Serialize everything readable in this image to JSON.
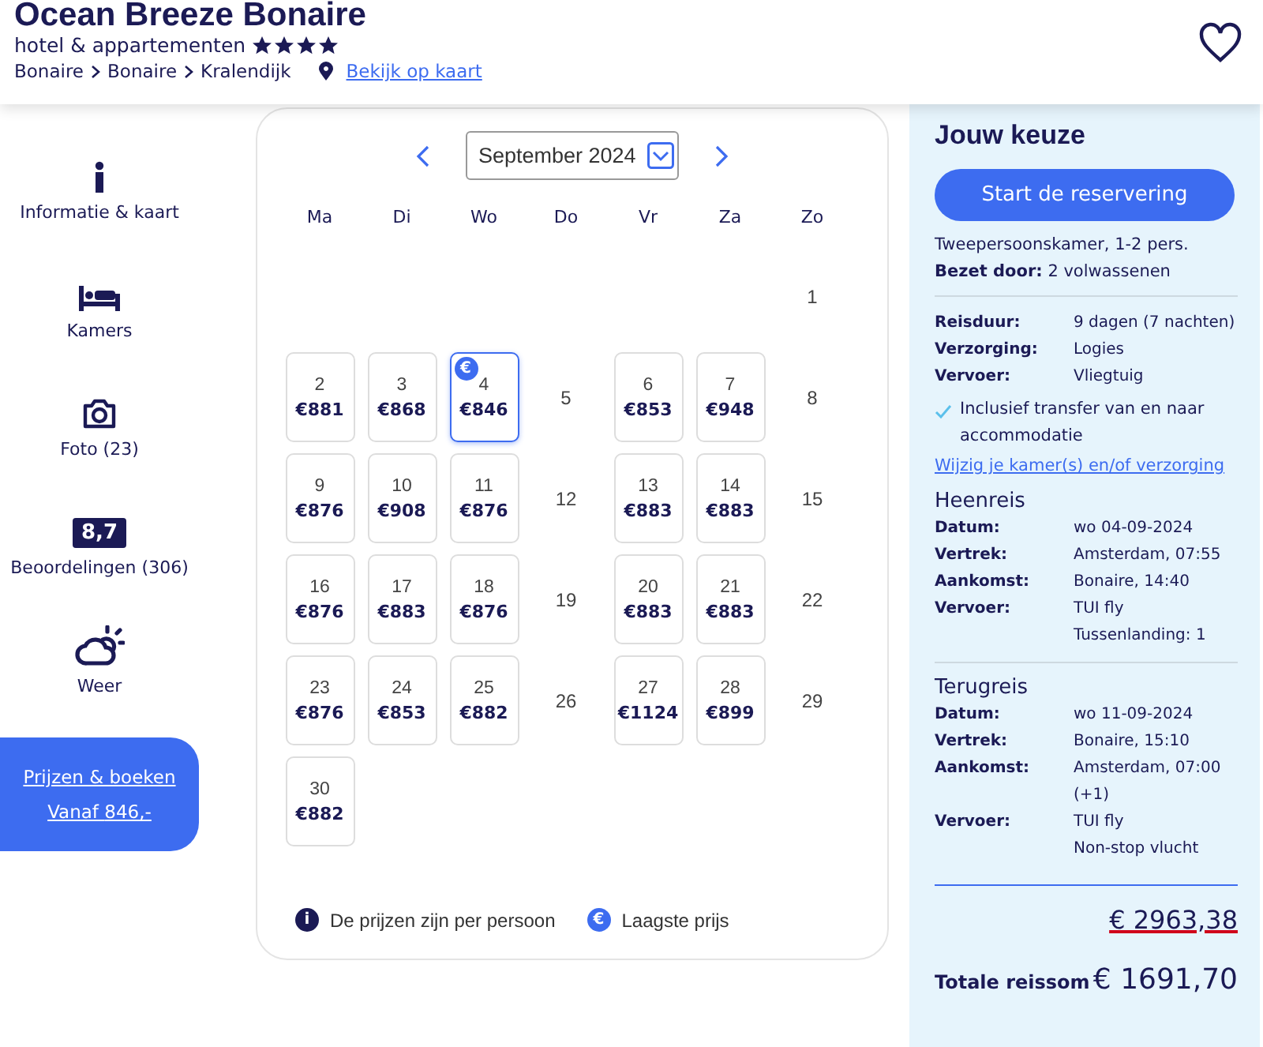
{
  "header": {
    "title": "Ocean Breeze Bonaire",
    "subtitle": "hotel & appartementen",
    "stars": 4,
    "breadcrumbs": [
      "Bonaire",
      "Bonaire",
      "Kralendijk"
    ],
    "map_link": "Bekijk op kaart"
  },
  "sidebar": {
    "items": [
      {
        "kind": "info",
        "label": "Informatie & kaart"
      },
      {
        "kind": "bed",
        "label": "Kamers"
      },
      {
        "kind": "camera",
        "label": "Foto (23)"
      },
      {
        "kind": "rating",
        "badge": "8,7",
        "label": "Beoordelingen (306)"
      },
      {
        "kind": "weather",
        "label": "Weer"
      }
    ],
    "book_button": {
      "label": "Prijzen & boeken",
      "from_label": "Vanaf",
      "price": "846,-"
    }
  },
  "calendar": {
    "month": "September 2024",
    "weekdays": [
      "Ma",
      "Di",
      "Wo",
      "Do",
      "Vr",
      "Za",
      "Zo"
    ],
    "weeks": [
      [
        {
          "kind": "blank"
        },
        {
          "kind": "blank"
        },
        {
          "kind": "blank"
        },
        {
          "kind": "blank"
        },
        {
          "kind": "blank"
        },
        {
          "kind": "blank"
        },
        {
          "kind": "plain",
          "day": "1"
        }
      ],
      [
        {
          "kind": "priced",
          "day": "2",
          "price": "€881",
          "selected": false
        },
        {
          "kind": "priced",
          "day": "3",
          "price": "€868",
          "selected": false
        },
        {
          "kind": "priced",
          "day": "4",
          "price": "€846",
          "selected": true,
          "lowest_badge": "€"
        },
        {
          "kind": "plain",
          "day": "5"
        },
        {
          "kind": "priced",
          "day": "6",
          "price": "€853",
          "selected": false
        },
        {
          "kind": "priced",
          "day": "7",
          "price": "€948",
          "selected": false
        },
        {
          "kind": "plain",
          "day": "8"
        }
      ],
      [
        {
          "kind": "priced",
          "day": "9",
          "price": "€876",
          "selected": false
        },
        {
          "kind": "priced",
          "day": "10",
          "price": "€908",
          "selected": false
        },
        {
          "kind": "priced",
          "day": "11",
          "price": "€876",
          "selected": false
        },
        {
          "kind": "plain",
          "day": "12"
        },
        {
          "kind": "priced",
          "day": "13",
          "price": "€883",
          "selected": false
        },
        {
          "kind": "priced",
          "day": "14",
          "price": "€883",
          "selected": false
        },
        {
          "kind": "plain",
          "day": "15"
        }
      ],
      [
        {
          "kind": "priced",
          "day": "16",
          "price": "€876",
          "selected": false
        },
        {
          "kind": "priced",
          "day": "17",
          "price": "€883",
          "selected": false
        },
        {
          "kind": "priced",
          "day": "18",
          "price": "€876",
          "selected": false
        },
        {
          "kind": "plain",
          "day": "19"
        },
        {
          "kind": "priced",
          "day": "20",
          "price": "€883",
          "selected": false
        },
        {
          "kind": "priced",
          "day": "21",
          "price": "€883",
          "selected": false
        },
        {
          "kind": "plain",
          "day": "22"
        }
      ],
      [
        {
          "kind": "priced",
          "day": "23",
          "price": "€876",
          "selected": false
        },
        {
          "kind": "priced",
          "day": "24",
          "price": "€853",
          "selected": false
        },
        {
          "kind": "priced",
          "day": "25",
          "price": "€882",
          "selected": false
        },
        {
          "kind": "plain",
          "day": "26"
        },
        {
          "kind": "priced",
          "day": "27",
          "price": "€1124",
          "selected": false
        },
        {
          "kind": "priced",
          "day": "28",
          "price": "€899",
          "selected": false
        },
        {
          "kind": "plain",
          "day": "29"
        }
      ],
      [
        {
          "kind": "priced",
          "day": "30",
          "price": "€882",
          "selected": false
        }
      ]
    ],
    "legend": [
      {
        "kind": "info",
        "icon": "i",
        "text": "De prijzen zijn per persoon"
      },
      {
        "kind": "lowest",
        "icon": "€",
        "text": "Laagste prijs"
      }
    ]
  },
  "summary": {
    "title": "Jouw keuze",
    "button": "Start de reservering",
    "room": "Tweepersoonskamer, 1-2 pers.",
    "occupancy": "**Bezet door:** 2 volwassenen",
    "details": [
      {
        "label": "Reisduur:",
        "lines": [
          "9 dagen (7 nachten)"
        ]
      },
      {
        "label": "Verzorging:",
        "lines": [
          "Logies"
        ]
      },
      {
        "label": "Vervoer:",
        "lines": [
          "Vliegtuig"
        ]
      }
    ],
    "included": "Inclusief transfer van en naar accommodatie",
    "change_link": "Wijzig je kamer(s) en/of verzorging",
    "legs": [
      {
        "title": "Heenreis",
        "rows": [
          {
            "label": "Datum:",
            "lines": [
              "wo 04-09-2024"
            ]
          },
          {
            "label": "Vertrek:",
            "lines": [
              "Amsterdam, 07:55"
            ]
          },
          {
            "label": "Aankomst:",
            "lines": [
              "Bonaire, 14:40"
            ]
          },
          {
            "label": "Vervoer:",
            "lines": [
              "TUI fly",
              "Tussenlanding: 1"
            ]
          }
        ]
      },
      {
        "title": "Terugreis",
        "rows": [
          {
            "label": "Datum:",
            "lines": [
              "wo 11-09-2024"
            ]
          },
          {
            "label": "Vertrek:",
            "lines": [
              "Bonaire, 15:10"
            ]
          },
          {
            "label": "Aankomst:",
            "lines": [
              "Amsterdam, 07:00",
              "(+1)"
            ]
          },
          {
            "label": "Vervoer:",
            "lines": [
              "TUI fly",
              "Non-stop vlucht"
            ]
          }
        ]
      }
    ],
    "old_price": "€ 2963,38",
    "total_label": "Totale reissom",
    "total": "€ 1691,70"
  }
}
